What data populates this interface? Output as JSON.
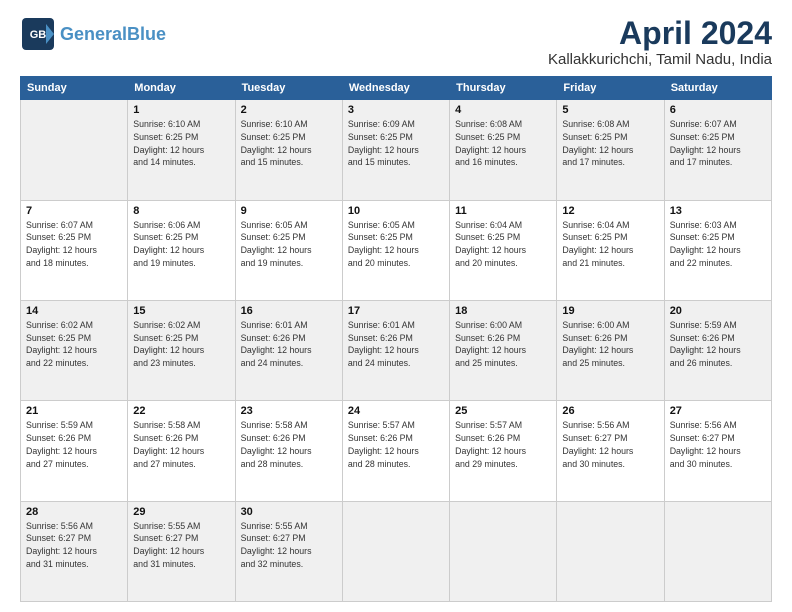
{
  "logo": {
    "line1": "General",
    "line2": "Blue"
  },
  "title": "April 2024",
  "subtitle": "Kallakkurichchi, Tamil Nadu, India",
  "weekdays": [
    "Sunday",
    "Monday",
    "Tuesday",
    "Wednesday",
    "Thursday",
    "Friday",
    "Saturday"
  ],
  "weeks": [
    [
      {
        "day": "",
        "info": ""
      },
      {
        "day": "1",
        "info": "Sunrise: 6:10 AM\nSunset: 6:25 PM\nDaylight: 12 hours\nand 14 minutes."
      },
      {
        "day": "2",
        "info": "Sunrise: 6:10 AM\nSunset: 6:25 PM\nDaylight: 12 hours\nand 15 minutes."
      },
      {
        "day": "3",
        "info": "Sunrise: 6:09 AM\nSunset: 6:25 PM\nDaylight: 12 hours\nand 15 minutes."
      },
      {
        "day": "4",
        "info": "Sunrise: 6:08 AM\nSunset: 6:25 PM\nDaylight: 12 hours\nand 16 minutes."
      },
      {
        "day": "5",
        "info": "Sunrise: 6:08 AM\nSunset: 6:25 PM\nDaylight: 12 hours\nand 17 minutes."
      },
      {
        "day": "6",
        "info": "Sunrise: 6:07 AM\nSunset: 6:25 PM\nDaylight: 12 hours\nand 17 minutes."
      }
    ],
    [
      {
        "day": "7",
        "info": "Sunrise: 6:07 AM\nSunset: 6:25 PM\nDaylight: 12 hours\nand 18 minutes."
      },
      {
        "day": "8",
        "info": "Sunrise: 6:06 AM\nSunset: 6:25 PM\nDaylight: 12 hours\nand 19 minutes."
      },
      {
        "day": "9",
        "info": "Sunrise: 6:05 AM\nSunset: 6:25 PM\nDaylight: 12 hours\nand 19 minutes."
      },
      {
        "day": "10",
        "info": "Sunrise: 6:05 AM\nSunset: 6:25 PM\nDaylight: 12 hours\nand 20 minutes."
      },
      {
        "day": "11",
        "info": "Sunrise: 6:04 AM\nSunset: 6:25 PM\nDaylight: 12 hours\nand 20 minutes."
      },
      {
        "day": "12",
        "info": "Sunrise: 6:04 AM\nSunset: 6:25 PM\nDaylight: 12 hours\nand 21 minutes."
      },
      {
        "day": "13",
        "info": "Sunrise: 6:03 AM\nSunset: 6:25 PM\nDaylight: 12 hours\nand 22 minutes."
      }
    ],
    [
      {
        "day": "14",
        "info": "Sunrise: 6:02 AM\nSunset: 6:25 PM\nDaylight: 12 hours\nand 22 minutes."
      },
      {
        "day": "15",
        "info": "Sunrise: 6:02 AM\nSunset: 6:25 PM\nDaylight: 12 hours\nand 23 minutes."
      },
      {
        "day": "16",
        "info": "Sunrise: 6:01 AM\nSunset: 6:26 PM\nDaylight: 12 hours\nand 24 minutes."
      },
      {
        "day": "17",
        "info": "Sunrise: 6:01 AM\nSunset: 6:26 PM\nDaylight: 12 hours\nand 24 minutes."
      },
      {
        "day": "18",
        "info": "Sunrise: 6:00 AM\nSunset: 6:26 PM\nDaylight: 12 hours\nand 25 minutes."
      },
      {
        "day": "19",
        "info": "Sunrise: 6:00 AM\nSunset: 6:26 PM\nDaylight: 12 hours\nand 25 minutes."
      },
      {
        "day": "20",
        "info": "Sunrise: 5:59 AM\nSunset: 6:26 PM\nDaylight: 12 hours\nand 26 minutes."
      }
    ],
    [
      {
        "day": "21",
        "info": "Sunrise: 5:59 AM\nSunset: 6:26 PM\nDaylight: 12 hours\nand 27 minutes."
      },
      {
        "day": "22",
        "info": "Sunrise: 5:58 AM\nSunset: 6:26 PM\nDaylight: 12 hours\nand 27 minutes."
      },
      {
        "day": "23",
        "info": "Sunrise: 5:58 AM\nSunset: 6:26 PM\nDaylight: 12 hours\nand 28 minutes."
      },
      {
        "day": "24",
        "info": "Sunrise: 5:57 AM\nSunset: 6:26 PM\nDaylight: 12 hours\nand 28 minutes."
      },
      {
        "day": "25",
        "info": "Sunrise: 5:57 AM\nSunset: 6:26 PM\nDaylight: 12 hours\nand 29 minutes."
      },
      {
        "day": "26",
        "info": "Sunrise: 5:56 AM\nSunset: 6:27 PM\nDaylight: 12 hours\nand 30 minutes."
      },
      {
        "day": "27",
        "info": "Sunrise: 5:56 AM\nSunset: 6:27 PM\nDaylight: 12 hours\nand 30 minutes."
      }
    ],
    [
      {
        "day": "28",
        "info": "Sunrise: 5:56 AM\nSunset: 6:27 PM\nDaylight: 12 hours\nand 31 minutes."
      },
      {
        "day": "29",
        "info": "Sunrise: 5:55 AM\nSunset: 6:27 PM\nDaylight: 12 hours\nand 31 minutes."
      },
      {
        "day": "30",
        "info": "Sunrise: 5:55 AM\nSunset: 6:27 PM\nDaylight: 12 hours\nand 32 minutes."
      },
      {
        "day": "",
        "info": ""
      },
      {
        "day": "",
        "info": ""
      },
      {
        "day": "",
        "info": ""
      },
      {
        "day": "",
        "info": ""
      }
    ]
  ]
}
